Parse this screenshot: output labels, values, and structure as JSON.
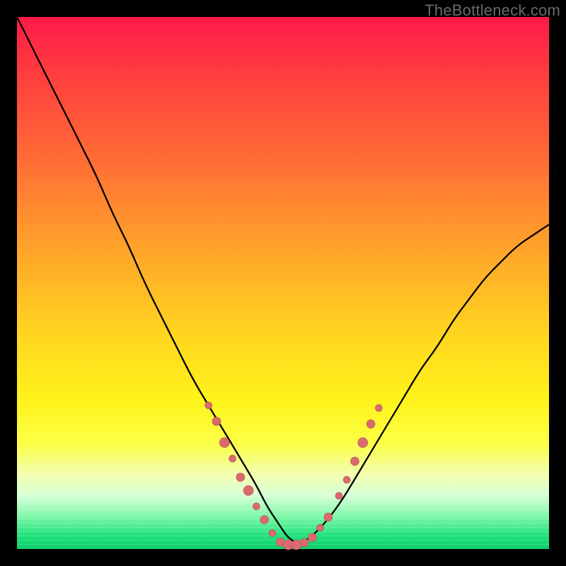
{
  "attribution": "TheBottleneck.com",
  "colors": {
    "frame_bg": "#000000",
    "curve_stroke": "#000000",
    "dot_fill": "#d96a6e",
    "dot_stroke": "#b64f56"
  },
  "chart_data": {
    "type": "line",
    "title": "",
    "xlabel": "",
    "ylabel": "",
    "xlim": [
      0,
      100
    ],
    "ylim": [
      0,
      100
    ],
    "annotations": [],
    "series": [
      {
        "name": "bottleneck-curve",
        "x": [
          0,
          3,
          6,
          9,
          12,
          15,
          18,
          21,
          24,
          27,
          30,
          33,
          36,
          39,
          42,
          45,
          47,
          49,
          51,
          53,
          55,
          58,
          61,
          64,
          67,
          70,
          73,
          76,
          79,
          82,
          85,
          88,
          91,
          94,
          97,
          100
        ],
        "y": [
          100,
          94,
          88,
          82,
          76,
          70,
          63,
          57,
          50,
          44,
          38,
          32,
          27,
          22,
          17,
          12,
          8,
          5,
          2,
          1,
          2,
          5,
          9,
          14,
          19,
          24,
          29,
          34,
          38,
          43,
          47,
          51,
          54,
          57,
          59,
          61
        ]
      }
    ],
    "scatter_points": {
      "name": "sample-dots",
      "points": [
        {
          "x": 36,
          "y": 27,
          "r": 5
        },
        {
          "x": 37.5,
          "y": 24,
          "r": 6
        },
        {
          "x": 39,
          "y": 20,
          "r": 7
        },
        {
          "x": 40.5,
          "y": 17,
          "r": 5
        },
        {
          "x": 42,
          "y": 13.5,
          "r": 6
        },
        {
          "x": 43.5,
          "y": 11,
          "r": 7
        },
        {
          "x": 45,
          "y": 8,
          "r": 5
        },
        {
          "x": 46.5,
          "y": 5.5,
          "r": 6
        },
        {
          "x": 48,
          "y": 3,
          "r": 5
        },
        {
          "x": 49.5,
          "y": 1.3,
          "r": 6
        },
        {
          "x": 51,
          "y": 0.8,
          "r": 7
        },
        {
          "x": 52.5,
          "y": 0.8,
          "r": 7
        },
        {
          "x": 54,
          "y": 1.2,
          "r": 6
        },
        {
          "x": 55.5,
          "y": 2.2,
          "r": 6
        },
        {
          "x": 57,
          "y": 4,
          "r": 5
        },
        {
          "x": 58.5,
          "y": 6,
          "r": 6
        },
        {
          "x": 60.5,
          "y": 10,
          "r": 5
        },
        {
          "x": 62,
          "y": 13,
          "r": 5
        },
        {
          "x": 63.5,
          "y": 16.5,
          "r": 6
        },
        {
          "x": 65,
          "y": 20,
          "r": 7
        },
        {
          "x": 66.5,
          "y": 23.5,
          "r": 6
        },
        {
          "x": 68,
          "y": 26.5,
          "r": 5
        }
      ]
    }
  }
}
